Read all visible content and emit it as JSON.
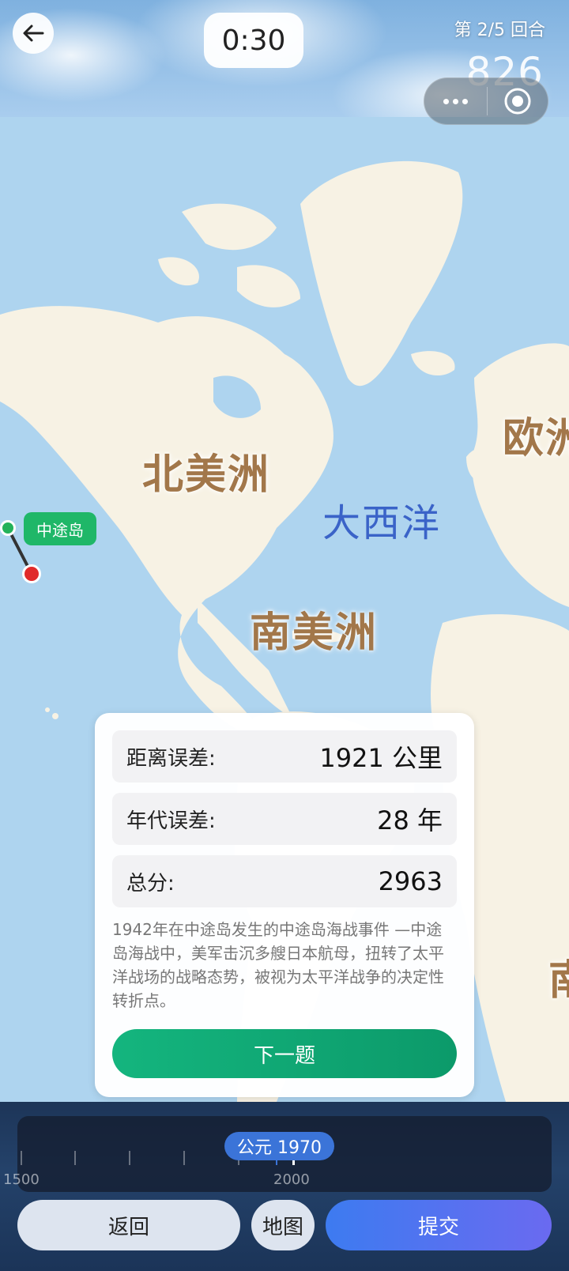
{
  "header": {
    "timer": "0:30",
    "round_text": "第 2/5 回合",
    "score": "826"
  },
  "map": {
    "labels": {
      "north_america": "北美洲",
      "south_america": "南美洲",
      "atlantic": "大西洋",
      "europe": "欧洲",
      "africa_partial": "南"
    },
    "pin_tag": "中途岛"
  },
  "result": {
    "distance_label": "距离误差:",
    "distance_value": "1921 公里",
    "era_label": "年代误差:",
    "era_value": "28 年",
    "total_label": "总分:",
    "total_value": "2963",
    "description": "1942年在中途岛发生的中途岛海战事件 —中途岛海战中，美军击沉多艘日本航母，扭转了太平洋战场的战略态势，被视为太平洋战争的决定性转折点。",
    "next_button": "下一题"
  },
  "timeline": {
    "current_year": "公元 1970",
    "tick_labels": [
      "1500",
      "2000"
    ]
  },
  "buttons": {
    "back": "返回",
    "map": "地图",
    "submit": "提交"
  },
  "colors": {
    "accent_green": "#14b57e",
    "accent_blue": "#3d7bf0",
    "pin_red": "#e02a2a",
    "pin_green": "#23b25a"
  }
}
